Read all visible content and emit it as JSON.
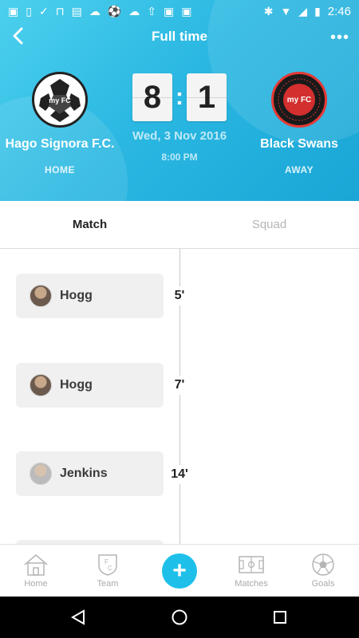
{
  "status_bar": {
    "time": "2:46",
    "left_icons": [
      "image-icon",
      "phone-download-icon",
      "check-icon",
      "overscan-icon",
      "keyboard-icon",
      "cloud-icon",
      "soccer-ball-icon",
      "cloud-icon",
      "upload-icon",
      "photo-check-icon",
      "photo-play-icon"
    ],
    "right_icons": [
      "bluetooth-icon",
      "wifi-icon",
      "signal-icon",
      "battery-icon"
    ]
  },
  "header": {
    "title": "Full time",
    "background_color": "#2bb8e2",
    "home_team": {
      "name": "Hago Signora F.C.",
      "side": "HOME",
      "score": "8",
      "crest_text": "my FC"
    },
    "away_team": {
      "name": "Black Swans",
      "side": "AWAY",
      "score": "1",
      "crest_text": "my FC"
    },
    "score_separator": ":",
    "date": "Wed, 3 Nov 2016",
    "time": "8:00 PM"
  },
  "tabs": [
    {
      "label": "Match",
      "active": true
    },
    {
      "label": "Squad",
      "active": false
    }
  ],
  "events": [
    {
      "player": "Hogg",
      "minute": "5'"
    },
    {
      "player": "Hogg",
      "minute": "7'"
    },
    {
      "player": "Jenkins",
      "minute": "14'"
    }
  ],
  "bottom_nav": {
    "items": [
      {
        "label": "Home",
        "icon": "house-icon"
      },
      {
        "label": "Team",
        "icon": "team-crest-icon"
      },
      {
        "label": "Matches",
        "icon": "pitch-icon"
      },
      {
        "label": "Goals",
        "icon": "soccer-ball-icon"
      }
    ],
    "add_label": "+",
    "accent_color": "#1ec0ea"
  }
}
